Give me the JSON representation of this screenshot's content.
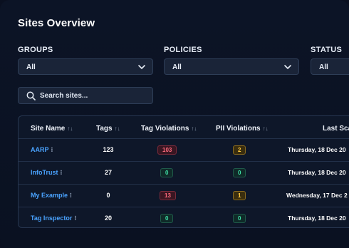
{
  "page": {
    "title": "Sites Overview"
  },
  "filters": {
    "groups": {
      "label": "GROUPS",
      "value": "All"
    },
    "policies": {
      "label": "POLICIES",
      "value": "All"
    },
    "status": {
      "label": "STATUS",
      "value": "All"
    }
  },
  "search": {
    "placeholder": "Search sites..."
  },
  "table": {
    "columns": [
      "Site Name",
      "Tags",
      "Tag Violations",
      "PII Violations",
      "Last Sca"
    ],
    "sort_glyph": "↑↓",
    "rows": [
      {
        "site": "AARP",
        "tags": "123",
        "tag_violations": "103",
        "tag_violations_status": "red",
        "pii_violations": "2",
        "pii_status": "amber",
        "last_scan": "Thursday, 18 Dec 20"
      },
      {
        "site": "InfoTrust",
        "tags": "27",
        "tag_violations": "0",
        "tag_violations_status": "green",
        "pii_violations": "0",
        "pii_status": "green",
        "last_scan": "Thursday, 18 Dec 20"
      },
      {
        "site": "My Example",
        "tags": "0",
        "tag_violations": "13",
        "tag_violations_status": "red",
        "pii_violations": "1",
        "pii_status": "amber",
        "last_scan": "Wednesday, 17 Dec 2"
      },
      {
        "site": "Tag Inspector",
        "tags": "20",
        "tag_violations": "0",
        "tag_violations_status": "green",
        "pii_violations": "0",
        "pii_status": "green",
        "last_scan": "Thursday, 18 Dec 20"
      }
    ],
    "row_menu_glyph": "⁝"
  },
  "colors": {
    "link": "#4aa3ff",
    "danger": "#ff6b7d",
    "success": "#3fe0a6",
    "warning": "#ffc940",
    "background": "#0a1121"
  },
  "icons": {
    "search": "search-icon",
    "select": "chevron-down-icon",
    "sort": "sort-icon"
  }
}
